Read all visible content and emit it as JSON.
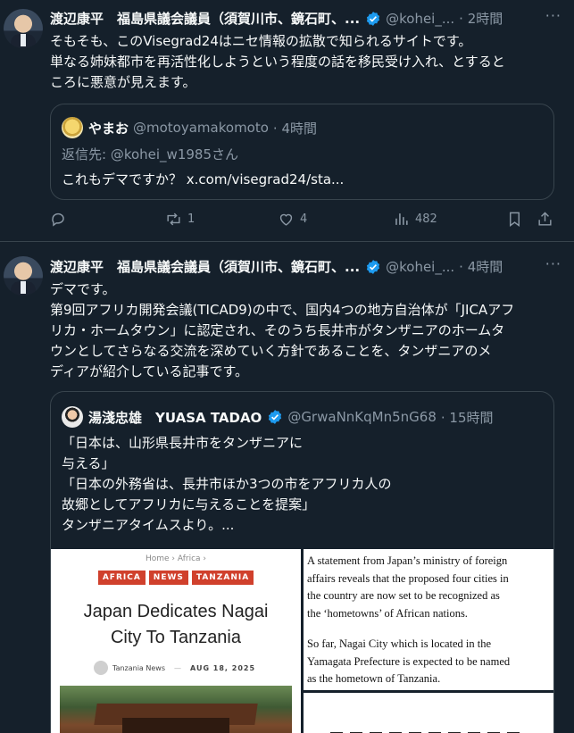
{
  "post1": {
    "author_name": "渡辺康平　福島県議会議員（須賀川市、鏡石町、...",
    "handle": "@kohei_...",
    "time": "· 2時間",
    "text_lines": [
      "そもそも、このVisegrad24はニセ情報の拡散で知られるサイトです。",
      "単なる姉妹都市を再活性化しようという程度の話を移民受け入れ、とすると",
      "ころに悪意が見えます。"
    ],
    "quote": {
      "author_name": "やまお",
      "handle": "@motoyamakomoto",
      "time": "· 4時間",
      "reply_to": "返信先: @kohei_w1985さん",
      "text": "これもデマですか？ x.com/visegrad24/sta..."
    },
    "actions": {
      "replies": "",
      "reposts": "1",
      "likes": "4",
      "views": "482"
    }
  },
  "post2": {
    "author_name": "渡辺康平　福島県議会議員（須賀川市、鏡石町、...",
    "handle": "@kohei_...",
    "time": "· 4時間",
    "text_lines": [
      "デマです。",
      "第9回アフリカ開発会議(TICAD9)の中で、国内4つの地方自治体が「JICAアフ",
      "リカ・ホームタウン」に認定され、そのうち長井市がタンザニアのホームタ",
      "ウンとしてさらなる交流を深めていく方針であることを、タンザニアのメ",
      "ディアが紹介している記事です。"
    ],
    "quote": {
      "author_name": "湯淺忠雄　YUASA TADAO",
      "handle": "@GrwaNnKqMn5nG68",
      "time": "· 15時間",
      "text_lines": [
        "「日本は、山形県長井市をタンザニアに",
        "与える」",
        "「日本の外務省は、長井市ほか3つの市をアフリカ人の",
        "故郷としてアフリカに与えることを提案」",
        "タンザニアタイムスより。..."
      ],
      "image_left": {
        "breadcrumb": "Home  ›  Africa  ›",
        "tags": [
          "AFRICA",
          "NEWS",
          "TANZANIA"
        ],
        "headline_1": "Japan Dedicates Nagai",
        "headline_2": "City To Tanzania",
        "source": "Tanzania News",
        "date": "AUG 18, 2025"
      },
      "image_right": {
        "para1_lines": [
          "A statement from Japan’s ministry of foreign",
          "affairs reveals that the proposed four cities in",
          "the country are now set to be recognized as",
          "the ‘hometowns’ of African nations."
        ],
        "para2_lines": [
          "So far, Nagai City which is located in the",
          "Yamagata Prefecture is expected to be named",
          "as the hometown of Tanzania."
        ]
      }
    }
  },
  "colors": {
    "background": "#15202b",
    "border": "#38444d",
    "muted_text": "#8b98a5",
    "verified_blue": "#1d9bf0",
    "tag_red": "#d0402c"
  }
}
